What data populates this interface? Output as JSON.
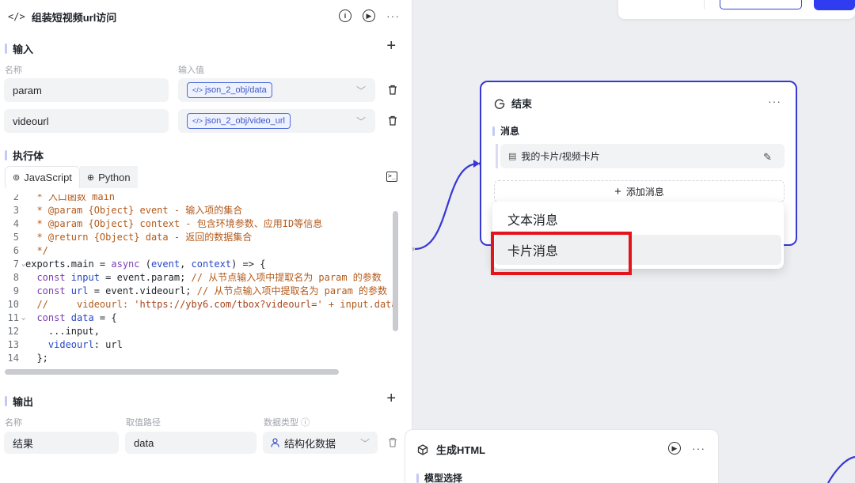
{
  "code_node": {
    "title": "组装短视频url访问",
    "input_section": "输入",
    "col_name": "名称",
    "col_value": "输入值",
    "inputs": [
      {
        "name": "param",
        "ref": "json_2_obj/data"
      },
      {
        "name": "videourl",
        "ref": "json_2_obj/video_url"
      }
    ],
    "body_section": "执行体",
    "tabs": [
      {
        "label": "JavaScript",
        "active": true
      },
      {
        "label": "Python",
        "active": false
      }
    ],
    "code_lines": [
      {
        "n": "2",
        "fold": false,
        "parts": [
          [
            "c-comment",
            "  * 入口函数 main"
          ]
        ]
      },
      {
        "n": "3",
        "fold": false,
        "parts": [
          [
            "c-comment",
            "  * @param {Object} event - 输入项的集合"
          ]
        ]
      },
      {
        "n": "4",
        "fold": false,
        "parts": [
          [
            "c-comment",
            "  * @param {Object} context - 包含环境参数、应用ID等信息"
          ]
        ]
      },
      {
        "n": "5",
        "fold": false,
        "parts": [
          [
            "c-comment",
            "  * @return {Object} data - 返回的数据集合"
          ]
        ]
      },
      {
        "n": "6",
        "fold": false,
        "parts": [
          [
            "c-comment",
            "  */"
          ]
        ]
      },
      {
        "n": "7",
        "fold": true,
        "parts": [
          [
            "c-plain",
            "exports.main = "
          ],
          [
            "c-kw",
            "async"
          ],
          [
            "c-plain",
            " ("
          ],
          [
            "c-var",
            "event"
          ],
          [
            "c-plain",
            ", "
          ],
          [
            "c-var",
            "context"
          ],
          [
            "c-plain",
            ") => {"
          ]
        ]
      },
      {
        "n": "8",
        "fold": false,
        "parts": [
          [
            "c-kw",
            "  const "
          ],
          [
            "c-var",
            "input"
          ],
          [
            "c-plain",
            " = event.param; "
          ],
          [
            "c-comment",
            "// 从节点输入项中提取名为 param 的参数"
          ]
        ]
      },
      {
        "n": "9",
        "fold": false,
        "parts": [
          [
            "c-kw",
            "  const "
          ],
          [
            "c-var",
            "url"
          ],
          [
            "c-plain",
            " = event.videourl; "
          ],
          [
            "c-comment",
            "// 从节点输入项中提取名为 param 的参数"
          ]
        ]
      },
      {
        "n": "10",
        "fold": false,
        "parts": [
          [
            "c-comment",
            "  //     videourl: "
          ],
          [
            "c-str",
            "'https://yby6.com/tbox?videourl='"
          ],
          [
            "c-comment",
            " + input.data"
          ]
        ]
      },
      {
        "n": "11",
        "fold": true,
        "parts": [
          [
            "c-kw",
            "  const "
          ],
          [
            "c-var",
            "data"
          ],
          [
            "c-plain",
            " = {"
          ]
        ]
      },
      {
        "n": "12",
        "fold": false,
        "parts": [
          [
            "c-plain",
            "    ...input,"
          ]
        ]
      },
      {
        "n": "13",
        "fold": false,
        "parts": [
          [
            "c-var",
            "    videourl"
          ],
          [
            "c-plain",
            ": url"
          ]
        ]
      },
      {
        "n": "14",
        "fold": false,
        "parts": [
          [
            "c-plain",
            "  };"
          ]
        ]
      }
    ],
    "output_section": "输出",
    "col_out_name": "名称",
    "col_out_path": "取值路径",
    "col_out_type": "数据类型",
    "output": {
      "name": "结果",
      "path": "data",
      "type": "结构化数据"
    }
  },
  "end_node": {
    "title": "结束",
    "message_section": "消息",
    "message_item": "我的卡片/视频卡片",
    "add_message": "添加消息"
  },
  "dropdown": {
    "items": [
      "文本消息",
      "卡片消息"
    ]
  },
  "gen_node": {
    "title": "生成HTML",
    "sub_section": "模型选择"
  },
  "colors": {
    "accent": "#3737d6",
    "highlight": "#e3141b",
    "ref_tag": "#4e6bd9"
  }
}
